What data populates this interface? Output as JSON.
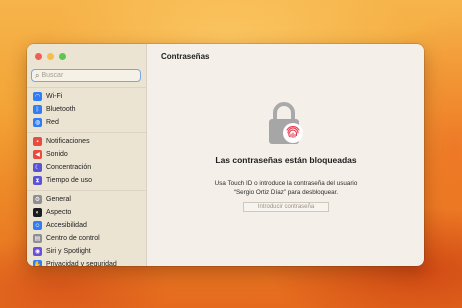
{
  "window": {
    "title": "Contraseñas"
  },
  "sidebar": {
    "search": {
      "placeholder": "Buscar"
    },
    "groups": [
      [
        {
          "label": "Wi-Fi",
          "icon": "wifi-icon",
          "color": "#2f7cf6",
          "glyph": "◠"
        },
        {
          "label": "Bluetooth",
          "icon": "bluetooth-icon",
          "color": "#2f7cf6",
          "glyph": "ᛒ"
        },
        {
          "label": "Red",
          "icon": "network-icon",
          "color": "#2f7cf6",
          "glyph": "◍"
        }
      ],
      [
        {
          "label": "Notificaciones",
          "icon": "notifications-icon",
          "color": "#ea4b3f",
          "glyph": "▪"
        },
        {
          "label": "Sonido",
          "icon": "sound-icon",
          "color": "#ea4b3f",
          "glyph": "◀"
        },
        {
          "label": "Concentración",
          "icon": "focus-icon",
          "color": "#5b53d6",
          "glyph": "☾"
        },
        {
          "label": "Tiempo de uso",
          "icon": "screen-time-icon",
          "color": "#5b53d6",
          "glyph": "⧗"
        }
      ],
      [
        {
          "label": "General",
          "icon": "gear-icon",
          "color": "#8e8e93",
          "glyph": "⚙"
        },
        {
          "label": "Aspecto",
          "icon": "appearance-icon",
          "color": "#1c1c1e",
          "glyph": "◐"
        },
        {
          "label": "Accesibilidad",
          "icon": "accessibility-icon",
          "color": "#2f7cf6",
          "glyph": "☺"
        },
        {
          "label": "Centro de control",
          "icon": "control-center-icon",
          "color": "#8e8e93",
          "glyph": "▤"
        },
        {
          "label": "Siri y Spotlight",
          "icon": "siri-icon",
          "color": "#6a4fd8",
          "glyph": "◉"
        },
        {
          "label": "Privacidad y seguridad",
          "icon": "privacy-icon",
          "color": "#2f7cf6",
          "glyph": "✋"
        }
      ]
    ]
  },
  "main": {
    "heading": "Las contraseñas están bloqueadas",
    "description": "Usa Touch ID o introduce la contraseña del usuario “Sergio Ortiz Díaz” para desbloquear.",
    "password_placeholder": "Introducir contraseña"
  }
}
